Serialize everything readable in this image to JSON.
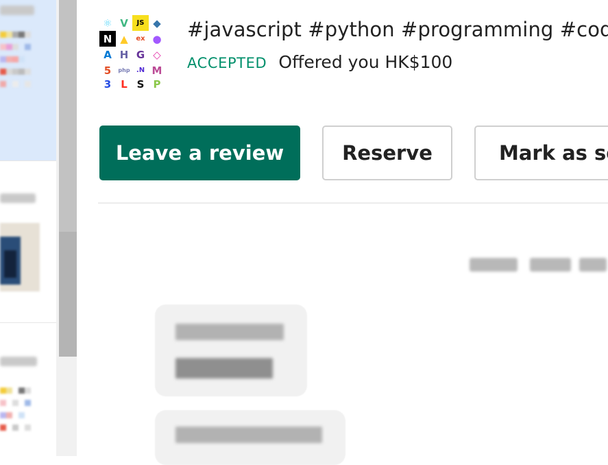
{
  "listing": {
    "title": "#javascript #python #programming #codin",
    "status_badge": "ACCEPTED",
    "offer_text": "Offered you HK$100",
    "thumbnail_icons": [
      {
        "name": "react-icon",
        "glyph": "⚛",
        "color": "#61dafb",
        "bg": "#ffffff"
      },
      {
        "name": "vue-icon",
        "glyph": "V",
        "color": "#41b883",
        "bg": "#ffffff"
      },
      {
        "name": "js-icon",
        "glyph": "JS",
        "color": "#000000",
        "bg": "#f7df1e"
      },
      {
        "name": "python-icon",
        "glyph": "◆",
        "color": "#3776ab",
        "bg": "#ffffff"
      },
      {
        "name": "nextjs-icon",
        "glyph": "N",
        "color": "#ffffff",
        "bg": "#000000"
      },
      {
        "name": "firebase-icon",
        "glyph": "▲",
        "color": "#ffca28",
        "bg": "#ffffff"
      },
      {
        "name": "express-icon",
        "glyph": "ex",
        "color": "#e44d26",
        "bg": "#ffffff"
      },
      {
        "name": "figma-icon",
        "glyph": "●",
        "color": "#a259ff",
        "bg": "#ffffff"
      },
      {
        "name": "azure-icon",
        "glyph": "A",
        "color": "#0078d4",
        "bg": "#ffffff"
      },
      {
        "name": "heroku-icon",
        "glyph": "H",
        "color": "#6762a6",
        "bg": "#ffffff"
      },
      {
        "name": "gatsby-icon",
        "glyph": "G",
        "color": "#663399",
        "bg": "#ffffff"
      },
      {
        "name": "graphql-icon",
        "glyph": "◇",
        "color": "#e535ab",
        "bg": "#ffffff"
      },
      {
        "name": "html5-icon",
        "glyph": "5",
        "color": "#e34f26",
        "bg": "#ffffff"
      },
      {
        "name": "php-icon",
        "glyph": "php",
        "color": "#777bb4",
        "bg": "#ffffff"
      },
      {
        "name": "dotnet-icon",
        "glyph": ".N",
        "color": "#512bd4",
        "bg": "#ffffff"
      },
      {
        "name": "motion-icon",
        "glyph": "M",
        "color": "#bb4b96",
        "bg": "#ffffff"
      },
      {
        "name": "css3-icon",
        "glyph": "3",
        "color": "#264de4",
        "bg": "#ffffff"
      },
      {
        "name": "laravel-icon",
        "glyph": "L",
        "color": "#ff2d20",
        "bg": "#ffffff"
      },
      {
        "name": "socket-icon",
        "glyph": "S",
        "color": "#111111",
        "bg": "#ffffff"
      },
      {
        "name": "proxy-icon",
        "glyph": "P",
        "color": "#8cc84b",
        "bg": "#ffffff"
      }
    ]
  },
  "actions": {
    "leave_review": "Leave a review",
    "reserve": "Reserve",
    "mark_as_sold": "Mark as so"
  },
  "colors": {
    "accent": "#006e5a",
    "accepted": "#008f6b",
    "sidebar_active": "#dbe9fb"
  }
}
